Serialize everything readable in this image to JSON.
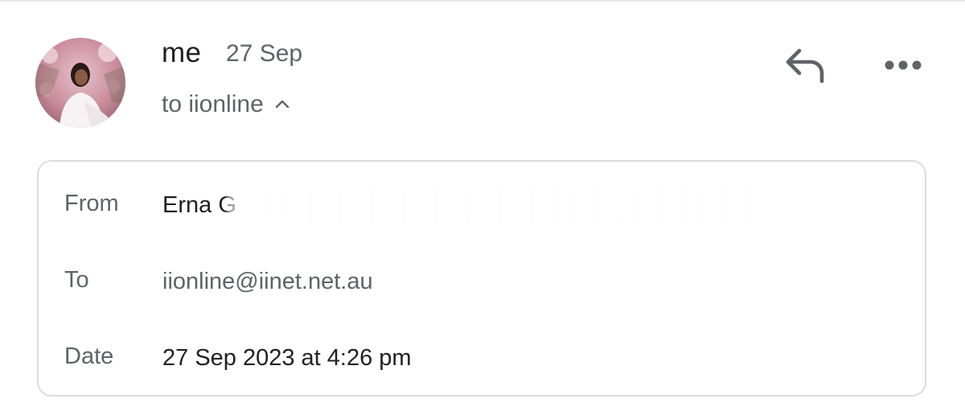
{
  "message": {
    "sender_name": "me",
    "sent_date": "27 Sep",
    "recipient_summary": "to iionline",
    "avatar_icon": "profile-photo",
    "actions": {
      "reply_icon": "reply-arrow-icon",
      "more_icon": "more-horizontal-icon"
    }
  },
  "details": {
    "from_label": "From",
    "from_value": "Erna G",
    "to_label": "To",
    "to_value": "iionline@iinet.net.au",
    "date_label": "Date",
    "date_value": "27 Sep 2023 at 4:26 pm"
  },
  "colors": {
    "primary_text": "#202124",
    "secondary_text": "#5f6368",
    "border": "#dadce0",
    "icon": "#5f6368"
  }
}
